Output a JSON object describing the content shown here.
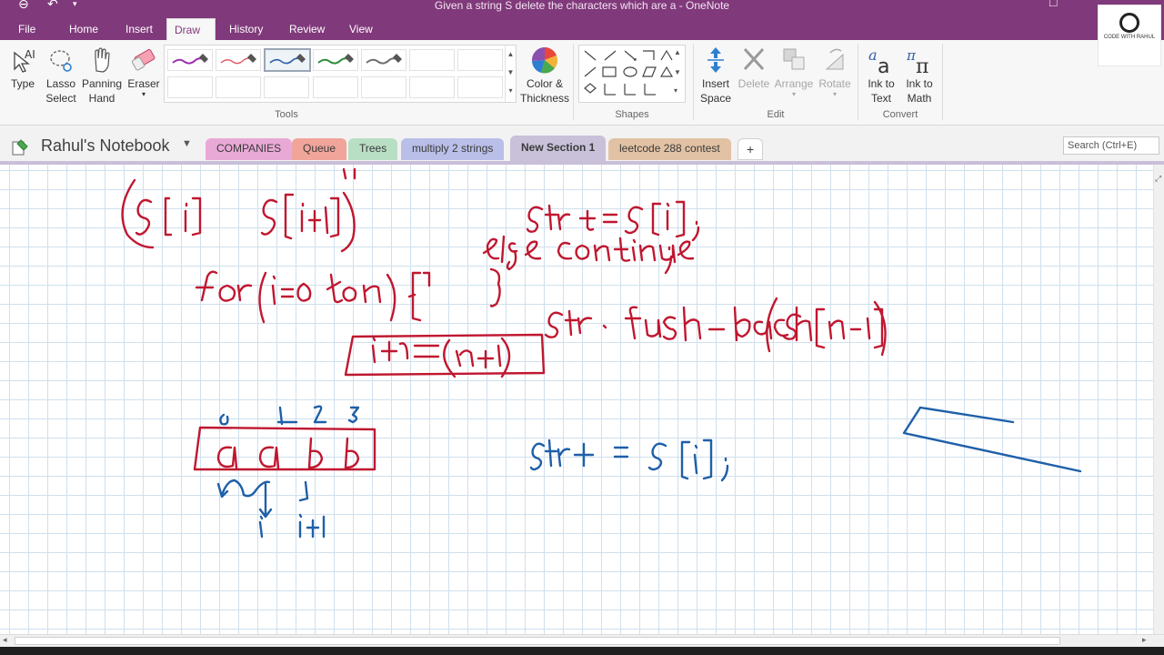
{
  "window": {
    "title": "Given a string S delete the characters which are a - OneNote"
  },
  "menu": {
    "tabs": [
      "File",
      "Home",
      "Insert",
      "Draw",
      "History",
      "Review",
      "View"
    ],
    "active": "Draw"
  },
  "ribbon": {
    "tools": {
      "type": "Type",
      "lasso": "Lasso\nSelect",
      "panning": "Panning\nHand",
      "eraser": "Eraser",
      "color_thickness": "Color &\nThickness",
      "group_label": "Tools"
    },
    "pens": [
      {
        "color": "#9b2fae"
      },
      {
        "color": "#e05a6a"
      },
      {
        "color": "#2f5fa7",
        "selected": true
      },
      {
        "color": "#2e8b3d"
      },
      {
        "color": "#6e6e6e"
      }
    ],
    "shapes": {
      "group_label": "Shapes"
    },
    "edit": {
      "insert_space": "Insert\nSpace",
      "delete": "Delete",
      "arrange": "Arrange",
      "rotate": "Rotate",
      "group_label": "Edit"
    },
    "convert": {
      "ink_to_text": "Ink to\nText",
      "ink_to_math": "Ink to\nMath",
      "group_label": "Convert"
    }
  },
  "notebook": {
    "name": "Rahul's Notebook",
    "sections": [
      {
        "label": "COMPANIES",
        "color": "#e9a9d6"
      },
      {
        "label": "Queue",
        "color": "#f1a49a"
      },
      {
        "label": "Trees",
        "color": "#b8dfc4"
      },
      {
        "label": "multiply 2 strings",
        "color": "#b9bfe8"
      },
      {
        "label": "New Section 1",
        "color": "#c9c1d9",
        "active": true
      },
      {
        "label": "leetcode 288 contest",
        "color": "#e2c2a4"
      },
      {
        "label": "+",
        "color": "#ffffff"
      }
    ],
    "search_placeholder": "Search (Ctrl+E)"
  },
  "logo": {
    "text": "CODE WITH RAHUL"
  },
  "ink": {
    "red_color": "#c0172f",
    "blue_color": "#1f5fa8"
  }
}
